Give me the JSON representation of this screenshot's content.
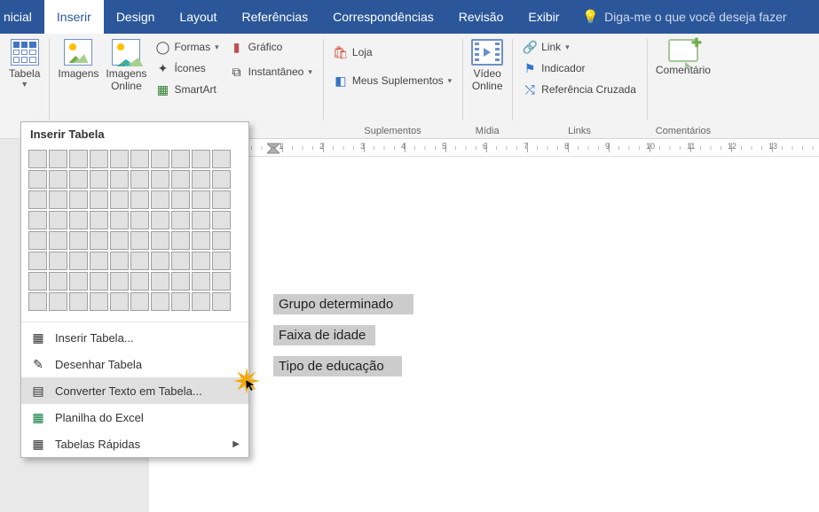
{
  "tabs": {
    "inicial": "nicial",
    "inserir": "Inserir",
    "design": "Design",
    "layout": "Layout",
    "referencias": "Referências",
    "correspondencias": "Correspondências",
    "revisao": "Revisão",
    "exibir": "Exibir",
    "tellme": "Diga-me o que você deseja fazer"
  },
  "ribbon": {
    "tabela": "Tabela",
    "imagens": "Imagens",
    "imagens_online": "Imagens\nOnline",
    "formas": "Formas",
    "icones": "Ícones",
    "smartart": "SmartArt",
    "grafico": "Gráfico",
    "instantaneo": "Instantâneo",
    "loja": "Loja",
    "meus_suplementos": "Meus Suplementos",
    "video_online": "Vídeo\nOnline",
    "link": "Link",
    "indicador": "Indicador",
    "ref_cruzada": "Referência Cruzada",
    "comentario": "Comentário",
    "grp_suplementos": "Suplementos",
    "grp_midia": "Mídia",
    "grp_links": "Links",
    "grp_comentarios": "Comentários"
  },
  "dropdown": {
    "title": "Inserir Tabela",
    "inserir_tabela": "Inserir Tabela...",
    "desenhar_tabela": "Desenhar Tabela",
    "converter": "Converter Texto em Tabela...",
    "planilha": "Planilha do Excel",
    "tabelas_rapidas": "Tabelas Rápidas"
  },
  "doc": {
    "l1": "Grupo determinado",
    "l2": "Faixa de idade",
    "l3": "Tipo de educação"
  },
  "ruler": {
    "nums": [
      "1",
      "2",
      "3",
      "4",
      "5",
      "6",
      "7",
      "8",
      "9",
      "10",
      "11",
      "12",
      "13"
    ]
  }
}
